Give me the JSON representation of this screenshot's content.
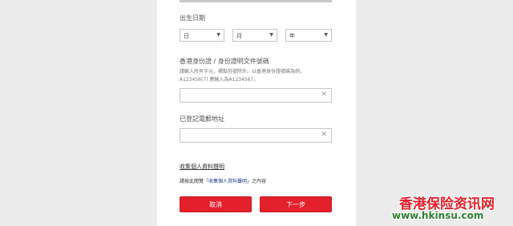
{
  "form": {
    "dob_label": "出生日期",
    "dob": {
      "day_value": "日",
      "month_value": "月",
      "year_value": "年",
      "arrow": "▼"
    },
    "id_label": "香港身份證 / 身份證明文件號碼",
    "id_hint_line1": "請輸入所有字元，標點符號除外。以香港身份證號碼為例，",
    "id_hint_line2": "A123456(7) 應輸入為A1234567。",
    "id_value": "",
    "email_label": "已登記電郵地址",
    "email_value": "",
    "clear_glyph": "✕",
    "privacy_link": "收集個人資料聲明",
    "privacy_notice_prefix": "請按此閱覽「",
    "privacy_notice_inner": "收集個人資料聲明",
    "privacy_notice_suffix": "」之內容",
    "cancel_label": "取消",
    "next_label": "下一步"
  },
  "watermark": {
    "cn": "香港保险资讯网",
    "url": "www.hkinsu.com"
  },
  "colors": {
    "accent": "#e4202c",
    "watermark_green": "#2e7d32"
  }
}
